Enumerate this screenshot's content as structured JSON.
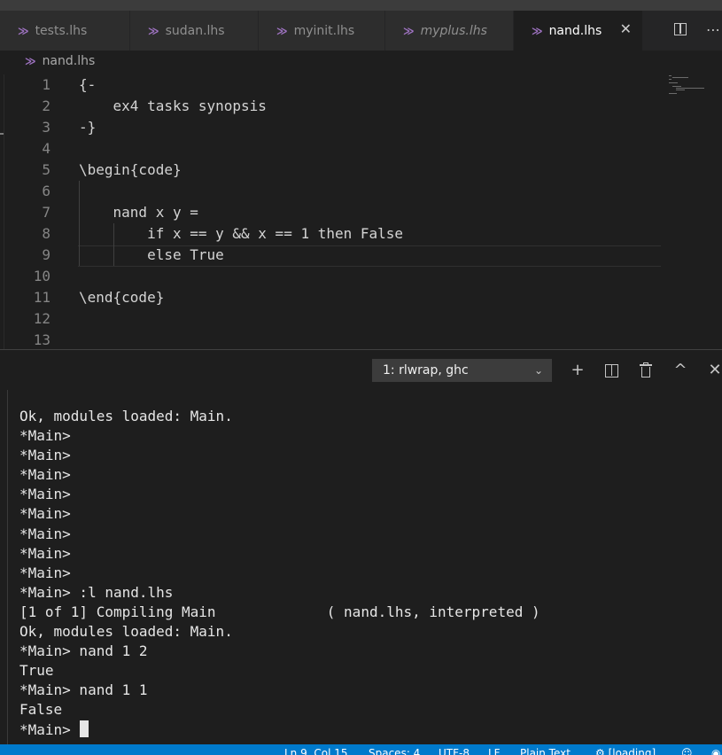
{
  "tabs": [
    {
      "label": "tests.lhs",
      "active": false,
      "italic": false
    },
    {
      "label": "sudan.lhs",
      "active": false,
      "italic": false
    },
    {
      "label": "myinit.lhs",
      "active": false,
      "italic": false
    },
    {
      "label": "myplus.lhs",
      "active": false,
      "italic": true
    },
    {
      "label": "nand.lhs",
      "active": true,
      "italic": false
    }
  ],
  "tab_icon_glyph": "≫",
  "close_glyph": "✕",
  "more_actions_glyph": "⋯",
  "breadcrumb": {
    "file": "nand.lhs"
  },
  "editor": {
    "lines": [
      {
        "n": "1",
        "text": "{-"
      },
      {
        "n": "2",
        "text": "    ex4 tasks synopsis"
      },
      {
        "n": "3",
        "text": "-}"
      },
      {
        "n": "4",
        "text": ""
      },
      {
        "n": "5",
        "text": "\\begin{code}"
      },
      {
        "n": "6",
        "text": ""
      },
      {
        "n": "7",
        "text": "    nand x y ="
      },
      {
        "n": "8",
        "text": "        if x == y && x == 1 then False"
      },
      {
        "n": "9",
        "text": "        else True"
      },
      {
        "n": "10",
        "text": ""
      },
      {
        "n": "11",
        "text": "\\end{code}"
      },
      {
        "n": "12",
        "text": ""
      },
      {
        "n": "13",
        "text": ""
      }
    ],
    "current_line": 9
  },
  "terminal": {
    "selected": "1: rlwrap, ghc",
    "actions": {
      "new": "+",
      "maximize": "^",
      "close": "✕"
    },
    "output": "Ok, modules loaded: Main.\n*Main>\n*Main>\n*Main>\n*Main>\n*Main>\n*Main>\n*Main>\n*Main>\n*Main> :l nand.lhs\n[1 of 1] Compiling Main             ( nand.lhs, interpreted )\nOk, modules loaded: Main.\n*Main> nand 1 2\nTrue\n*Main> nand 1 1\nFalse\n*Main> "
  },
  "statusbar": {
    "position": "Ln 9, Col 15",
    "indent": "Spaces: 4",
    "encoding": "UTF-8",
    "eol": "LF",
    "language": "Plain Text",
    "loading": "[loading]"
  },
  "colors": {
    "accent": "#007acc",
    "haskell_icon": "#a074c4",
    "editor_bg": "#1e1e1e",
    "tab_inactive_bg": "#2d2d2d"
  }
}
